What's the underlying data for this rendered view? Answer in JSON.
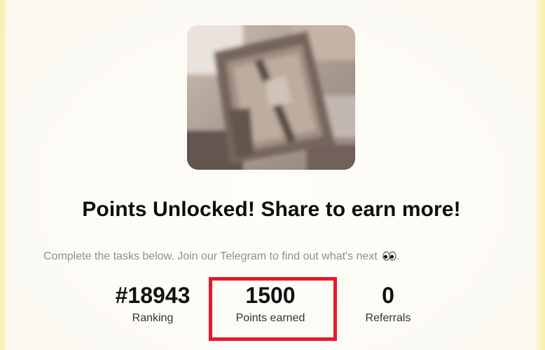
{
  "colors": {
    "page_bg": "#fdf6d8",
    "card_bg": "#fffdf9",
    "title": "#0d0d0d",
    "subtitle": "#8a8f9a",
    "highlight": "#e8182a"
  },
  "hero": {
    "image_icon": "blurred-photo-wooden-frame"
  },
  "heading": "Points Unlocked! Share to earn more!",
  "subtitle": "Complete the tasks below. Join our Telegram to find out what's next",
  "subtitle_suffix": ".",
  "subtitle_icon": "eyes-emoji-icon",
  "stats": {
    "ranking": {
      "value": "#18943",
      "label": "Ranking"
    },
    "points": {
      "value": "1500",
      "label": "Points earned"
    },
    "referrals": {
      "value": "0",
      "label": "Referrals"
    }
  }
}
